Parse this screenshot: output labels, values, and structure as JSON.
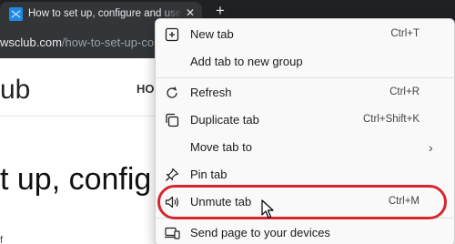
{
  "tab": {
    "title": "How to set up, configure and use",
    "close_glyph": "✕",
    "new_tab_glyph": "+"
  },
  "address": {
    "host": "wsclub.com",
    "path": "/how-to-set-up-co"
  },
  "page": {
    "logo": "ub",
    "nav": "HO",
    "article_title": "t up, config",
    "fragment": "f"
  },
  "context_menu": {
    "new_tab": {
      "label": "New tab",
      "shortcut": "Ctrl+T",
      "icon": "new-tab-icon"
    },
    "add_to_group": {
      "label": "Add tab to new group"
    },
    "refresh": {
      "label": "Refresh",
      "shortcut": "Ctrl+R",
      "icon": "refresh-icon"
    },
    "duplicate": {
      "label": "Duplicate tab",
      "shortcut": "Ctrl+Shift+K",
      "icon": "duplicate-icon"
    },
    "move_to": {
      "label": "Move tab to",
      "arrow": "›"
    },
    "pin": {
      "label": "Pin tab",
      "icon": "pin-icon"
    },
    "unmute": {
      "label": "Unmute tab",
      "shortcut": "Ctrl+M",
      "icon": "speaker-icon"
    },
    "send_page": {
      "label": "Send page to your devices",
      "icon": "devices-icon"
    }
  },
  "colors": {
    "highlight": "#d6262c",
    "menu_bg": "#f9f9f9",
    "chrome_dark": "#202124"
  }
}
